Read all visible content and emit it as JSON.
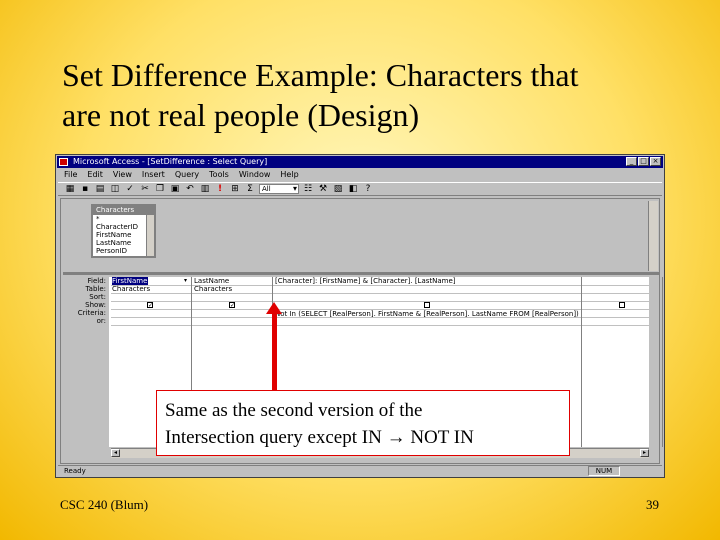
{
  "slide": {
    "title_line1": "Set Difference Example: Characters that",
    "title_line2": "are not real people (Design)",
    "footer_left": "CSC 240 (Blum)",
    "footer_right": "39"
  },
  "window": {
    "title": "Microsoft Access - [SetDifference : Select Query]",
    "menus": [
      "File",
      "Edit",
      "View",
      "Insert",
      "Query",
      "Tools",
      "Window",
      "Help"
    ],
    "toolbar_combo": "All",
    "status_ready": "Ready",
    "status_num": "NUM"
  },
  "field_list": {
    "title": "Characters",
    "items": [
      "*",
      "CharacterID",
      "FirstName",
      "LastName",
      "PersonID"
    ]
  },
  "grid": {
    "row_labels": [
      "Field:",
      "Table:",
      "Sort:",
      "Show:",
      "Criteria:",
      "or:"
    ],
    "col1_field": "FirstName",
    "col1_table": "Characters",
    "col2_field": "LastName",
    "col2_table": "Characters",
    "col3_field": "[Character]: [FirstName] & [Character]. [LastName]",
    "col3_criteria": "Not In (SELECT [RealPerson]. FirstName & [RealPerson]. LastName FROM [RealPerson])"
  },
  "callout": {
    "line1": "Same as the second version of the",
    "line2": "Intersection query except IN → NOT IN"
  },
  "colors": {
    "arrow": "#e00000",
    "titlebar": "#000080"
  }
}
